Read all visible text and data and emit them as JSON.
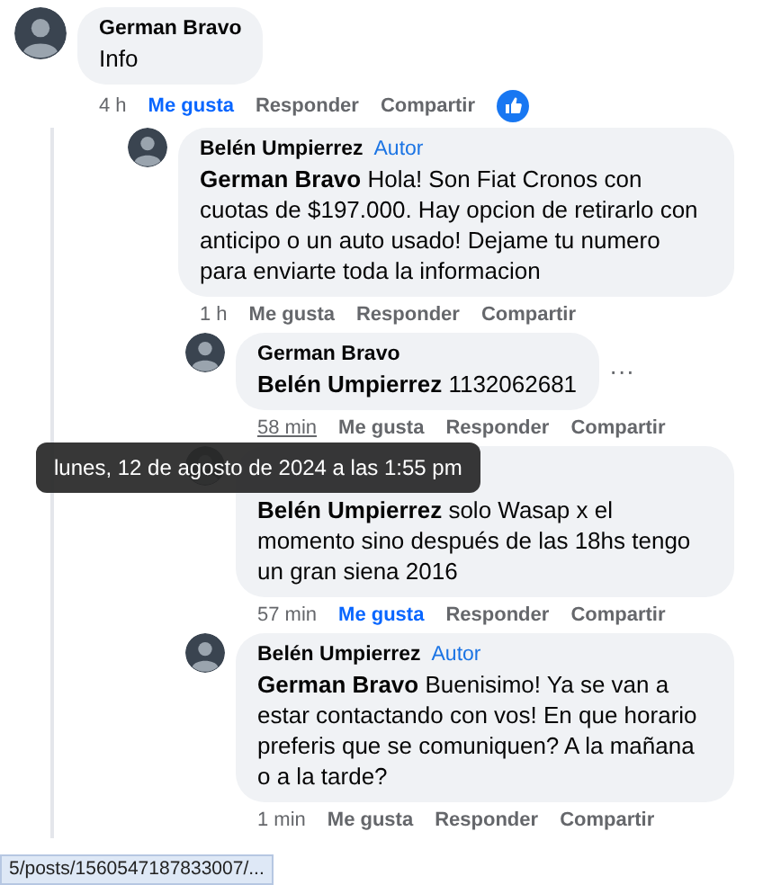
{
  "comments": [
    {
      "author": "German Bravo",
      "text": "Info",
      "time": "4 h",
      "liked": true,
      "time_hover": false,
      "has_reaction": true,
      "actions": [
        "Me gusta",
        "Responder",
        "Compartir"
      ],
      "children": [
        {
          "author": "Belén Umpierrez",
          "badge": "Autor",
          "text": "**German Bravo** Hola! Son Fiat Cronos con cuotas de $197.000. Hay opcion de retirarlo con anticipo o un auto usado! Dejame tu numero para enviarte toda la informacion",
          "time": "1 h",
          "liked": false,
          "time_hover": false,
          "actions": [
            "Me gusta",
            "Responder",
            "Compartir"
          ],
          "children": [
            {
              "author": "German Bravo",
              "text": "**Belén Umpierrez** 1132062681",
              "time": "58 min",
              "liked": false,
              "time_hover": true,
              "more": "···",
              "actions": [
                "Me gusta",
                "Responder",
                "Compartir"
              ]
            },
            {
              "text": "**Belén Umpierrez** solo Wasap x el momento sino después de las 18hs tengo un gran siena 2016",
              "time": "57 min",
              "liked": true,
              "time_hover": false,
              "actions": [
                "Me gusta",
                "Responder",
                "Compartir"
              ]
            },
            {
              "author": "Belén Umpierrez",
              "badge": "Autor",
              "text": "**German Bravo** Buenisimo! Ya se van a estar contactando con vos! En que horario preferis que se comuniquen? A la mañana o a la tarde?",
              "time": "1 min",
              "liked": false,
              "time_hover": false,
              "actions": [
                "Me gusta",
                "Responder",
                "Compartir"
              ]
            }
          ]
        }
      ]
    }
  ],
  "tooltip": {
    "text": "lunes, 12 de agosto de 2024 a las 1:55 pm"
  },
  "status_bar": {
    "url": "5/posts/1560547187833007/..."
  }
}
